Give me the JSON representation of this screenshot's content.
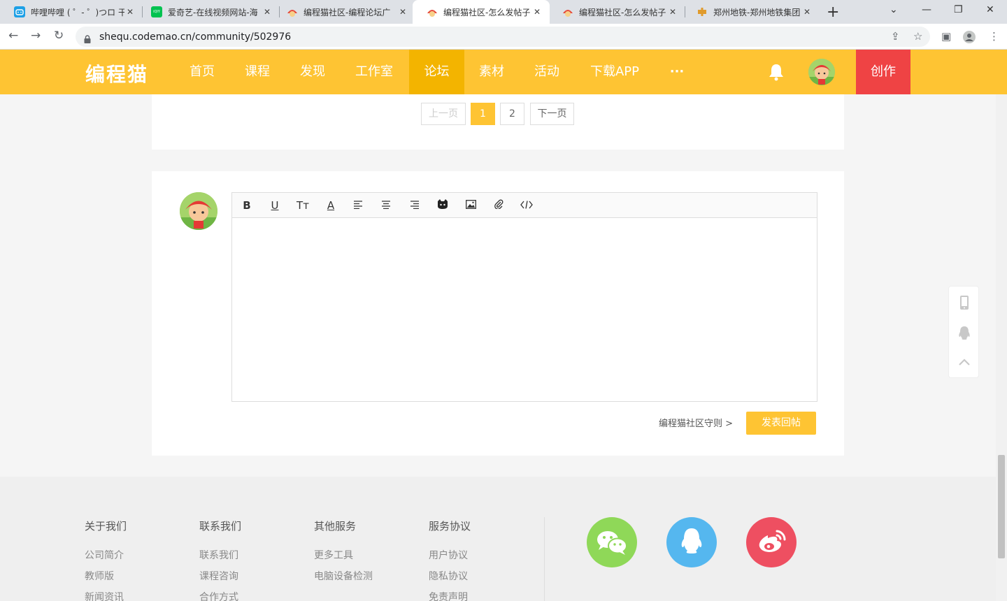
{
  "browser": {
    "tabs": [
      {
        "label": "哔哩哔哩 ( ゜- ゜)つロ 干",
        "icon": "bilibili-icon",
        "color": "#1da0e6"
      },
      {
        "label": "爱奇艺-在线视频网站-海",
        "icon": "iqiyi-icon",
        "color": "#00c250"
      },
      {
        "label": "编程猫社区-编程论坛广",
        "icon": "codemao-icon",
        "color": "#e55"
      },
      {
        "label": "编程猫社区-怎么发帖子",
        "icon": "codemao-icon",
        "color": "#e55"
      },
      {
        "label": "编程猫社区-怎么发帖子",
        "icon": "codemao-icon",
        "color": "#e55"
      },
      {
        "label": "郑州地铁-郑州地铁集团",
        "icon": "zhengzhou-metro-icon",
        "color": "#e09b2d"
      }
    ],
    "new_tab": "+",
    "url": "shequ.codemao.cn/community/502976"
  },
  "header": {
    "logo": "编程猫",
    "nav": [
      "首页",
      "课程",
      "发现",
      "工作室",
      "论坛",
      "素材",
      "活动",
      "下载APP",
      "···"
    ],
    "active_nav": "论坛",
    "create_label": "创作",
    "accent_color": "#fec433",
    "create_color": "#ef4344"
  },
  "pagination": {
    "prev": "上一页",
    "pages": [
      "1",
      "2"
    ],
    "current": "1",
    "next": "下一页"
  },
  "reply": {
    "toolbar": [
      "bold",
      "underline",
      "font-size",
      "font-color",
      "align-left",
      "align-center",
      "align-right",
      "emoji-cat",
      "image",
      "attachment",
      "code"
    ],
    "rules_link": "编程猫社区守则 >",
    "submit_label": "发表回帖"
  },
  "footer": {
    "columns": [
      {
        "title": "关于我们",
        "links": [
          "公司简介",
          "教师版",
          "新闻资讯"
        ]
      },
      {
        "title": "联系我们",
        "links": [
          "联系我们",
          "课程咨询",
          "合作方式"
        ]
      },
      {
        "title": "其他服务",
        "links": [
          "更多工具",
          "电脑设备检测"
        ]
      },
      {
        "title": "服务协议",
        "links": [
          "用户协议",
          "隐私协议",
          "免责声明"
        ]
      }
    ],
    "social": [
      {
        "name": "wechat",
        "color": "#8fd858"
      },
      {
        "name": "qq",
        "color": "#55b7ef"
      },
      {
        "name": "weibo",
        "color": "#ee4f61"
      }
    ]
  }
}
